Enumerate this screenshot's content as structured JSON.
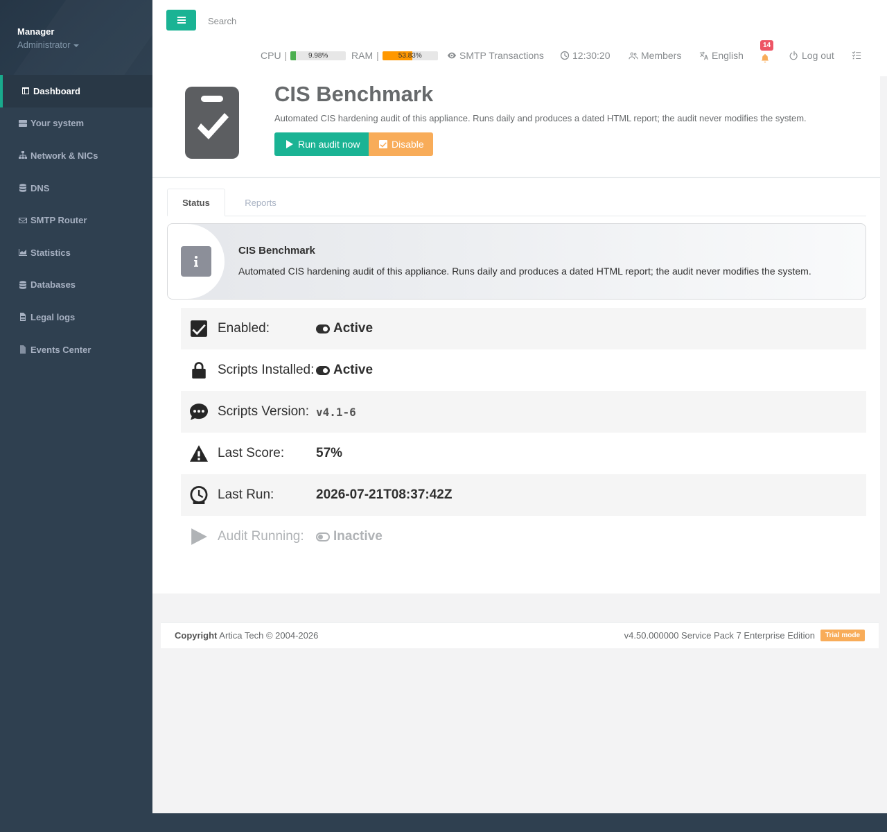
{
  "sidebar": {
    "profile": {
      "name": "Manager",
      "role": "Administrator"
    },
    "items": [
      {
        "label": "Dashboard",
        "icon": "layout-icon",
        "active": true
      },
      {
        "label": "Your system",
        "icon": "server-icon"
      },
      {
        "label": "Network & NICs",
        "icon": "sitemap-icon"
      },
      {
        "label": "DNS",
        "icon": "database-icon"
      },
      {
        "label": "SMTP Router",
        "icon": "envelope-icon"
      },
      {
        "label": "Statistics",
        "icon": "chart-area-icon"
      },
      {
        "label": "Databases",
        "icon": "database-icon"
      },
      {
        "label": "Legal logs",
        "icon": "file-icon"
      },
      {
        "label": "Events Center",
        "icon": "file-text-icon"
      }
    ]
  },
  "topbar": {
    "search_placeholder": "Search",
    "cpu": {
      "label": "CPU",
      "sep": "|",
      "value_text": "9.98%",
      "value": 9.98,
      "color": "#4caf50"
    },
    "ram": {
      "label": "RAM",
      "sep": "|",
      "value_text": "53.83%",
      "value": 53.83,
      "color": "#ff9800"
    },
    "smtp_label": "SMTP Transactions",
    "clock": "12:30:20",
    "members_label": "Members",
    "language": "English",
    "notifications_count": "14",
    "logout_label": "Log out"
  },
  "header": {
    "title": "CIS Benchmark",
    "description": "Automated CIS hardening audit of this appliance. Runs daily and produces a dated HTML report; the audit never modifies the system.",
    "run_button": "Run audit now",
    "disable_button": "Disable"
  },
  "tabs": [
    {
      "label": "Status",
      "active": true
    },
    {
      "label": "Reports",
      "active": false
    }
  ],
  "info_box": {
    "title": "CIS Benchmark",
    "text": "Automated CIS hardening audit of this appliance. Runs daily and produces a dated HTML report; the audit never modifies the system."
  },
  "status": {
    "enabled": {
      "label": "Enabled:",
      "value": "Active",
      "icon": "check-square-icon"
    },
    "scripts_installed": {
      "label": "Scripts Installed:",
      "value": "Active",
      "icon": "lock-icon"
    },
    "scripts_version": {
      "label": "Scripts Version:",
      "value": "v4.1-6",
      "icon": "comment-dots-icon"
    },
    "last_score": {
      "label": "Last Score:",
      "value": "57%",
      "icon": "warning-icon"
    },
    "last_run": {
      "label": "Last Run:",
      "value": "2026-07-21T08:37:42Z",
      "icon": "clock-icon"
    },
    "audit_running": {
      "label": "Audit Running:",
      "value": "Inactive",
      "icon": "play-icon"
    }
  },
  "footer": {
    "copyright_bold": "Copyright",
    "copyright_text": "Artica Tech © 2004-2026",
    "version": "v4.50.000000 Service Pack 7 Enterprise Edition",
    "trial": "Trial mode"
  },
  "colors": {
    "accent": "#1ab394",
    "warning": "#f8ac59",
    "sidebar": "#2f4050",
    "danger": "#ed5565"
  }
}
